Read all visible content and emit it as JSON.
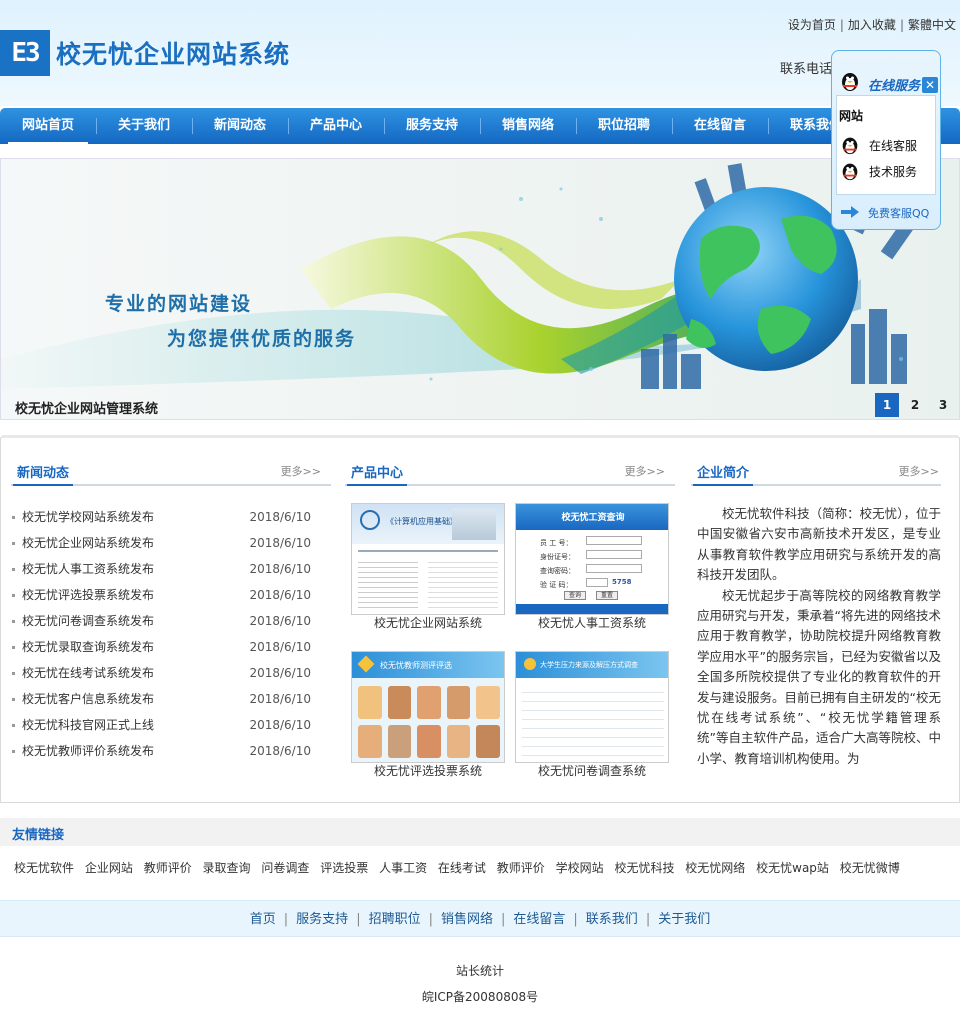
{
  "header": {
    "logo_mark": "ЕЗ",
    "site_name": "校无忧企业网站系统",
    "toplinks": [
      "设为首页",
      "加入收藏",
      "繁體中文"
    ],
    "phone_label": "联系电话"
  },
  "nav": [
    "网站首页",
    "关于我们",
    "新闻动态",
    "产品中心",
    "服务支持",
    "销售网络",
    "职位招聘",
    "在线留言",
    "联系我们"
  ],
  "banner": {
    "line1": "专业的网站建设",
    "line2": "为您提供优质的服务",
    "caption": "校无忧企业网站管理系统",
    "pages": [
      "1",
      "2",
      "3"
    ],
    "active_page": "1"
  },
  "news": {
    "title": "新闻动态",
    "more": "更多>>",
    "items": [
      {
        "title": "校无忧学校网站系统发布",
        "date": "2018/6/10"
      },
      {
        "title": "校无忧企业网站系统发布",
        "date": "2018/6/10"
      },
      {
        "title": "校无忧人事工资系统发布",
        "date": "2018/6/10"
      },
      {
        "title": "校无忧评选投票系统发布",
        "date": "2018/6/10"
      },
      {
        "title": "校无忧问卷调查系统发布",
        "date": "2018/6/10"
      },
      {
        "title": "校无忧录取查询系统发布",
        "date": "2018/6/10"
      },
      {
        "title": "校无忧在线考试系统发布",
        "date": "2018/6/10"
      },
      {
        "title": "校无忧客户信息系统发布",
        "date": "2018/6/10"
      },
      {
        "title": "校无忧科技官网正式上线",
        "date": "2018/6/10"
      },
      {
        "title": "校无忧教师评价系统发布",
        "date": "2018/6/10"
      }
    ]
  },
  "products": {
    "title": "产品中心",
    "more": "更多>>",
    "items": [
      {
        "label": "校无忧企业网站系统",
        "thumb_title": "《计算机应用基础》"
      },
      {
        "label": "校无忧人事工资系统",
        "thumb_title": "校无忧工资查询"
      },
      {
        "label": "校无忧评选投票系统",
        "thumb_title": "校无忧教师测评评选"
      },
      {
        "label": "校无忧问卷调查系统",
        "thumb_title": "大学生压力来源及解压方式调查"
      }
    ],
    "salary_form": {
      "fields": [
        "员 工 号：",
        "身份证号：",
        "查询密码：",
        "验 证 码："
      ],
      "code": "5758",
      "buttons": [
        "查询",
        "重置"
      ]
    }
  },
  "intro": {
    "title": "企业简介",
    "more": "更多>>",
    "paragraphs": [
      "校无忧软件科技（简称：校无忧），位于中国安徽省六安市高新技术开发区，是专业从事教育软件教学应用研究与系统开发的高科技开发团队。",
      "校无忧起步于高等院校的网络教育教学应用研究与开发，秉承着“将先进的网络技术应用于教育教学，协助院校提升网络教育教学应用水平”的服务宗旨，已经为安徽省以及全国多所院校提供了专业化的教育软件的开发与建设服务。目前已拥有自主研发的“校无忧在线考试系统”、“校无忧学籍管理系统”等自主软件产品，适合广大高等院校、中小学、教育培训机构使用。为"
    ]
  },
  "friends": {
    "title": "友情链接",
    "links": [
      "校无忧软件",
      "企业网站",
      "教师评价",
      "录取查询",
      "问卷调查",
      "评选投票",
      "人事工资",
      "在线考试",
      "教师评价",
      "学校网站",
      "校无忧科技",
      "校无忧网络",
      "校无忧wap站",
      "校无忧微博"
    ]
  },
  "footer": {
    "nav": [
      "首页",
      "服务支持",
      "招聘职位",
      "销售网络",
      "在线留言",
      "联系我们",
      "关于我们"
    ],
    "stat": "站长统计",
    "icp": "皖ICP备20080808号"
  },
  "qq": {
    "header": "在线服务",
    "close": "✕",
    "group": "网站",
    "services": [
      "在线客服",
      "技术服务"
    ],
    "footer": "免费客服QQ"
  },
  "colors": {
    "brand_blue": "#1a67c2",
    "nav_top": "#2f92e2",
    "nav_bottom": "#1468c1",
    "header_bg": "#dff2fd"
  }
}
